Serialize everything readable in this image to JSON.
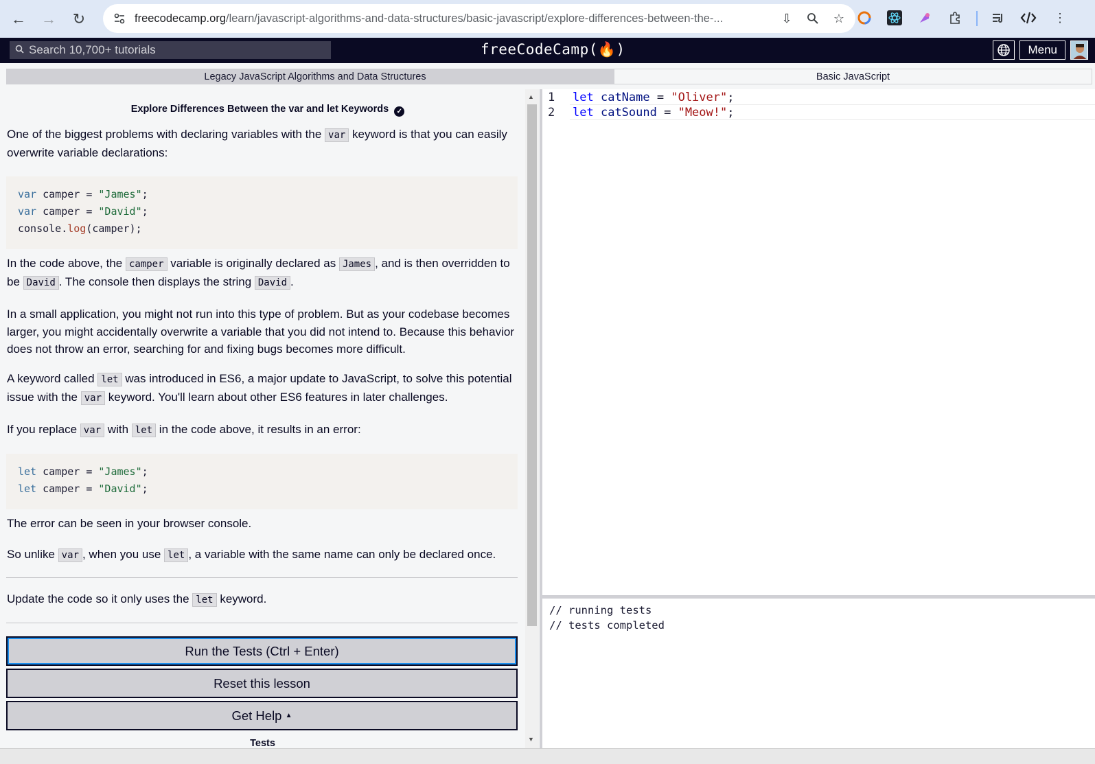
{
  "browser": {
    "url_host": "freecodecamp.org",
    "url_path": "/learn/javascript-algorithms-and-data-structures/basic-javascript/explore-differences-between-the-..."
  },
  "nav": {
    "search_placeholder": "Search 10,700+ tutorials",
    "logo": "freeCodeCamp(🔥)",
    "menu_label": "Menu"
  },
  "breadcrumb": {
    "superblock": "Legacy JavaScript Algorithms and Data Structures",
    "block": "Basic JavaScript"
  },
  "challenge": {
    "title": "Explore Differences Between the var and let Keywords",
    "p1_a": "One of the biggest problems with declaring variables with the ",
    "p1_code": "var",
    "p1_b": " keyword is that you can easily overwrite variable declarations:",
    "code1": [
      {
        "kw": "var",
        "rest1": " camper = ",
        "str": "\"James\"",
        "rest2": ";"
      },
      {
        "kw": "var",
        "rest1": " camper = ",
        "str": "\"David\"",
        "rest2": ";"
      }
    ],
    "code1_line3_a": "console.",
    "code1_line3_fn": "log",
    "code1_line3_b": "(camper);",
    "p2_a": "In the code above, the ",
    "p2_code1": "camper",
    "p2_b": " variable is originally declared as ",
    "p2_code2": "James",
    "p2_c": ", and is then overridden to be ",
    "p2_code3": "David",
    "p2_d": ". The console then displays the string ",
    "p2_code4": "David",
    "p2_e": ".",
    "p3": "In a small application, you might not run into this type of problem. But as your codebase becomes larger, you might accidentally overwrite a variable that you did not intend to. Because this behavior does not throw an error, searching for and fixing bugs becomes more difficult.",
    "p4_a": "A keyword called ",
    "p4_code1": "let",
    "p4_b": " was introduced in ES6, a major update to JavaScript, to solve this potential issue with the ",
    "p4_code2": "var",
    "p4_c": " keyword. You'll learn about other ES6 features in later challenges.",
    "p5_a": "If you replace ",
    "p5_code1": "var",
    "p5_b": " with ",
    "p5_code2": "let",
    "p5_c": " in the code above, it results in an error:",
    "code2": [
      {
        "kw": "let",
        "rest1": " camper = ",
        "str": "\"James\"",
        "rest2": ";"
      },
      {
        "kw": "let",
        "rest1": " camper = ",
        "str": "\"David\"",
        "rest2": ";"
      }
    ],
    "p6": "The error can be seen in your browser console.",
    "p7_a": "So unlike ",
    "p7_code1": "var",
    "p7_b": ", when you use ",
    "p7_code2": "let",
    "p7_c": ", a variable with the same name can only be declared once.",
    "instr_a": "Update the code so it only uses the ",
    "instr_code": "let",
    "instr_b": " keyword."
  },
  "buttons": {
    "run": "Run the Tests (Ctrl + Enter)",
    "reset": "Reset this lesson",
    "help": "Get Help",
    "help_caret": "▲"
  },
  "tests_label": "Tests",
  "editor": {
    "lines": [
      {
        "num": "1",
        "kw": "let",
        "var": "catName",
        "op": " = ",
        "str": "\"Oliver\"",
        "end": ";"
      },
      {
        "num": "2",
        "kw": "let",
        "var": "catSound",
        "op": " = ",
        "str": "\"Meow!\"",
        "end": ";"
      }
    ]
  },
  "console": {
    "line1": "// running tests",
    "line2": "// tests completed"
  }
}
